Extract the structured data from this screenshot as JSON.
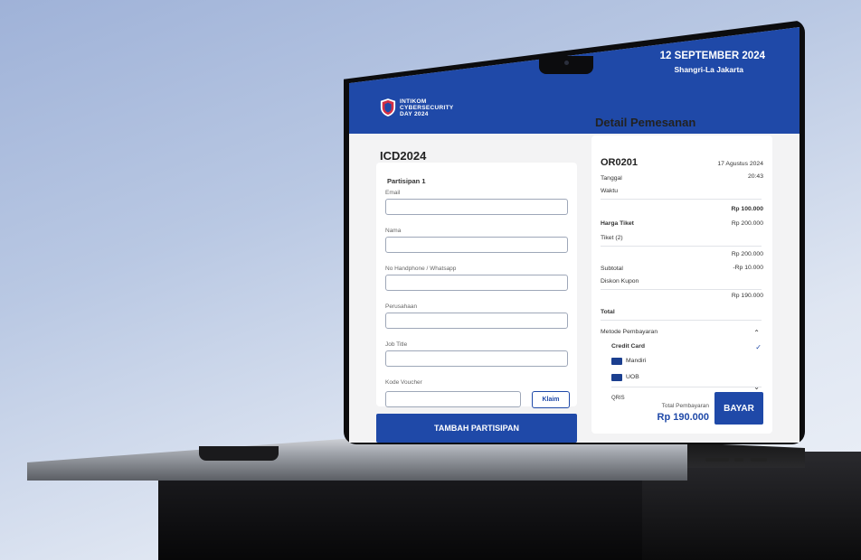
{
  "header": {
    "logo_text": "INTIKOM CYBERSECURITY DAY 2024",
    "event_date": "12 SEPTEMBER 2024",
    "event_venue": "Shangri-La Jakarta"
  },
  "form": {
    "title": "ICD2024",
    "participant_label": "Partisipan 1",
    "fields": [
      {
        "label": "Email",
        "value": ""
      },
      {
        "label": "Nama",
        "value": ""
      },
      {
        "label": "No Handphone / Whatsapp",
        "value": ""
      },
      {
        "label": "Perusahaan",
        "value": ""
      },
      {
        "label": "Job Title",
        "value": ""
      }
    ],
    "voucher_label": "Kode Voucher",
    "voucher_value": "",
    "claim_button": "Klaim",
    "add_participant_button": "TAMBAH PARTISIPAN"
  },
  "order": {
    "title": "Detail Pemesanan",
    "order_id": "OR0201",
    "date_label": "Tanggal",
    "date_value": "17 Agustus 2024",
    "time_label": "Waktu",
    "time_value": "20:43",
    "ticket_price_label": "Harga Tiket",
    "ticket_price_value": "Rp 100.000",
    "ticket_qty_label": "Tiket (2)",
    "ticket_qty_value": "Rp 200.000",
    "subtotal_label": "Subtotal",
    "subtotal_value": "Rp 200.000",
    "discount_label": "Diskon Kupon",
    "discount_value": "-Rp 10.000",
    "total_label": "Total",
    "total_value": "Rp 190.000",
    "payment_method_label": "Metode Pembayaran",
    "credit_card_label": "Credit Card",
    "banks": [
      "Mandiri",
      "UOB"
    ],
    "qris_label": "QRIS",
    "total_payment_label": "Total Pembayaran",
    "total_payment_value": "Rp 190.000",
    "pay_button": "BAYAR"
  },
  "colors": {
    "brand_blue": "#1f49a8",
    "background": "#f3f3f4"
  }
}
